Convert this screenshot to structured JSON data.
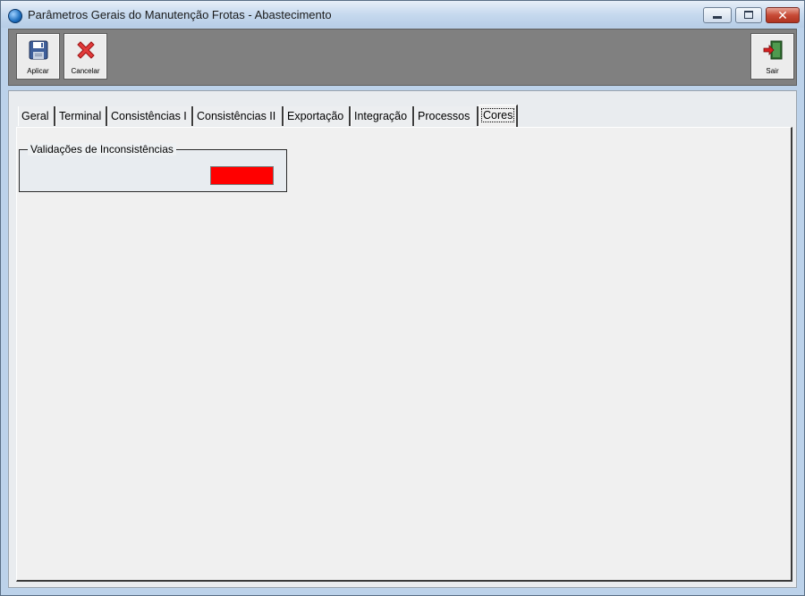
{
  "window": {
    "title": "Parâmetros Gerais do Manutenção Frotas - Abastecimento",
    "close_symbol": "✕"
  },
  "toolbar": {
    "aplicar_label": "Aplicar",
    "cancelar_label": "Cancelar",
    "sair_label": "Sair",
    "icons": [
      "floppy-save-icon",
      "red-x-cancel-icon",
      "exit-door-icon"
    ]
  },
  "tabs": [
    {
      "label": "Geral"
    },
    {
      "label": "Terminal"
    },
    {
      "label": "Consistências I"
    },
    {
      "label": "Consistências II"
    },
    {
      "label": "Exportação"
    },
    {
      "label": "Integração"
    },
    {
      "label": "Processos"
    },
    {
      "label": "Cores",
      "active": true
    }
  ],
  "cores": {
    "group_title": "Validações de Inconsistências",
    "swatch_color": "#ff0000"
  }
}
